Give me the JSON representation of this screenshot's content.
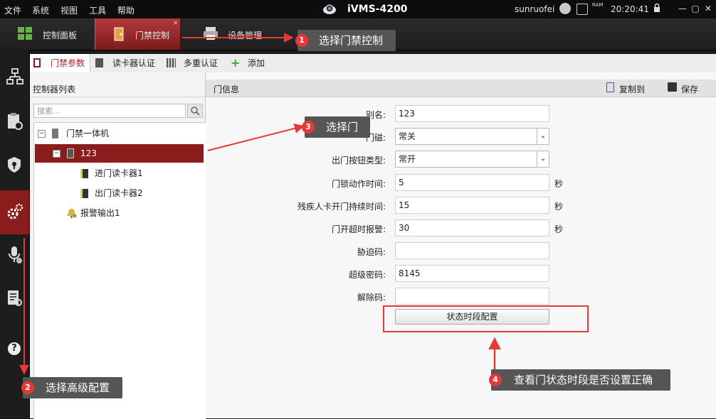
{
  "menubar": {
    "items": [
      "文件",
      "系统",
      "视图",
      "工具",
      "帮助"
    ],
    "app_title": "iVMS-4200",
    "username": "sunruofei",
    "ram_label": "RAM",
    "clock": "20:20:41"
  },
  "tabs": [
    {
      "label": "控制面板",
      "icon": "dashboard-icon"
    },
    {
      "label": "门禁控制",
      "icon": "door-access-icon",
      "active": true
    },
    {
      "label": "设备管理",
      "icon": "printer-device-icon"
    }
  ],
  "subtabs": [
    {
      "label": "门禁参数",
      "icon": "door-params-icon",
      "active": true
    },
    {
      "label": "读卡器认证",
      "icon": "card-reader-auth-icon"
    },
    {
      "label": "多重认证",
      "icon": "multi-auth-icon"
    },
    {
      "label": "添加",
      "icon": "plus-icon"
    }
  ],
  "controller_list": {
    "title": "控制器列表",
    "search_placeholder": "搜索...",
    "tree": {
      "root": "门禁一体机",
      "door": "123",
      "readers": [
        "进门读卡器1",
        "出门读卡器2"
      ],
      "alarm_output": "报警输出1"
    }
  },
  "door_info": {
    "title": "门信息",
    "copy_to": "复制到",
    "save": "保存",
    "fields": {
      "alias": {
        "label": "别名:",
        "value": "123"
      },
      "door_magnet": {
        "label": "门磁:",
        "value": "常关"
      },
      "exit_button": {
        "label": "出门按钮类型:",
        "value": "常开"
      },
      "lock_action_time": {
        "label": "门锁动作时间:",
        "value": "5",
        "unit": "秒"
      },
      "disabled_open_time": {
        "label": "残疾人卡开门持续时间:",
        "value": "15",
        "unit": "秒"
      },
      "open_timeout_alarm": {
        "label": "门开超时报警:",
        "value": "30",
        "unit": "秒"
      },
      "duress_code": {
        "label": "胁迫码:",
        "value": ""
      },
      "super_password": {
        "label": "超级密码:",
        "value": "8145"
      },
      "dismiss_code": {
        "label": "解除码:",
        "value": ""
      }
    },
    "state_schedule_button": "状态时段配置"
  },
  "annotations": [
    {
      "num": "1",
      "text": "选择门禁控制"
    },
    {
      "num": "2",
      "text": "选择高级配置"
    },
    {
      "num": "3",
      "text": "选择门"
    },
    {
      "num": "4",
      "text": "查看门状态时段是否设置正确"
    }
  ],
  "colors": {
    "accent_red": "#8b1c1c",
    "callout_bg": "#555555",
    "annotation_red": "#e53935"
  }
}
